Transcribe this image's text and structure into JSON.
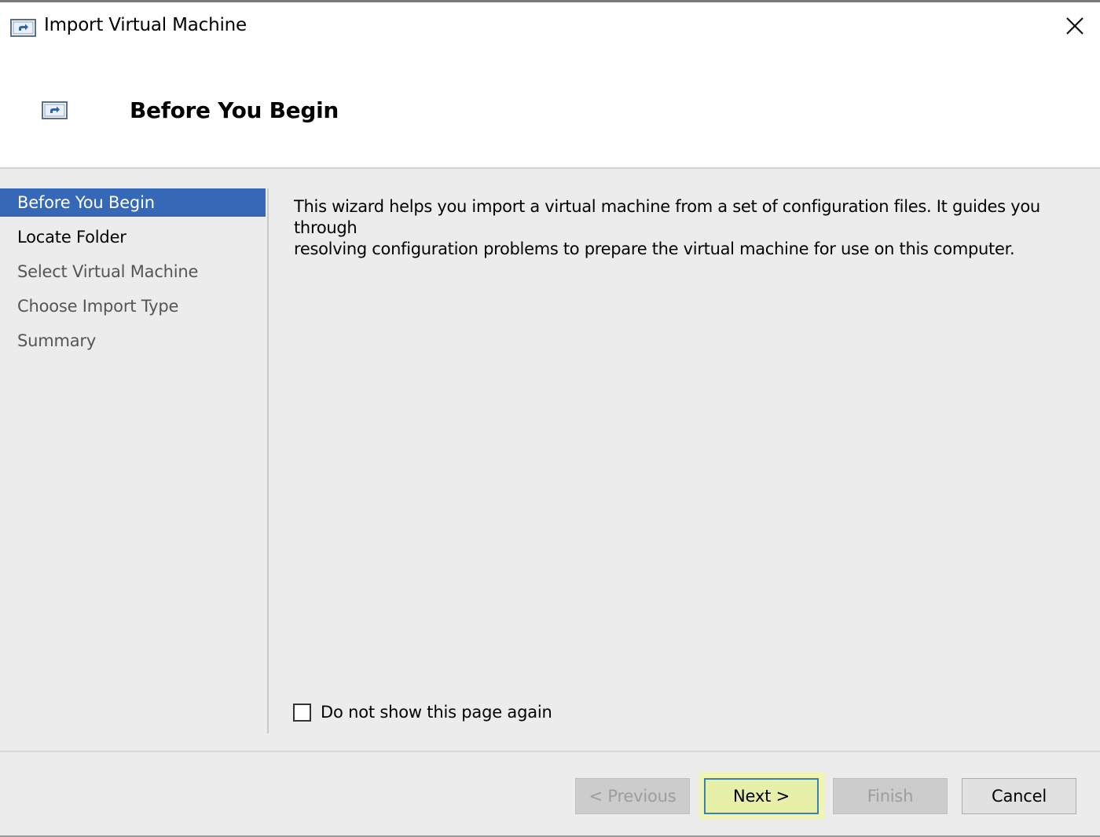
{
  "window": {
    "title": "Import Virtual Machine"
  },
  "header": {
    "title": "Before You Begin"
  },
  "steps": [
    {
      "label": "Before You Begin",
      "state": "active"
    },
    {
      "label": "Locate Folder",
      "state": "enabled"
    },
    {
      "label": "Select Virtual Machine",
      "state": "disabled"
    },
    {
      "label": "Choose Import Type",
      "state": "disabled"
    },
    {
      "label": "Summary",
      "state": "disabled"
    }
  ],
  "content": {
    "description_line1": "This wizard helps you import a virtual machine from a set of configuration files. It guides you through",
    "description_line2": "resolving configuration problems to prepare the virtual machine for use on this computer.",
    "checkbox_label": "Do not show this page again",
    "checkbox_checked": false
  },
  "buttons": {
    "previous": "< Previous",
    "next": "Next >",
    "finish": "Finish",
    "cancel": "Cancel"
  },
  "icons": {
    "title": "import-vm-icon",
    "header": "import-vm-icon",
    "close": "close-icon"
  },
  "colors": {
    "active_step": "#3568b7",
    "highlight": "#f1f5b4",
    "body_bg": "#ececec"
  }
}
